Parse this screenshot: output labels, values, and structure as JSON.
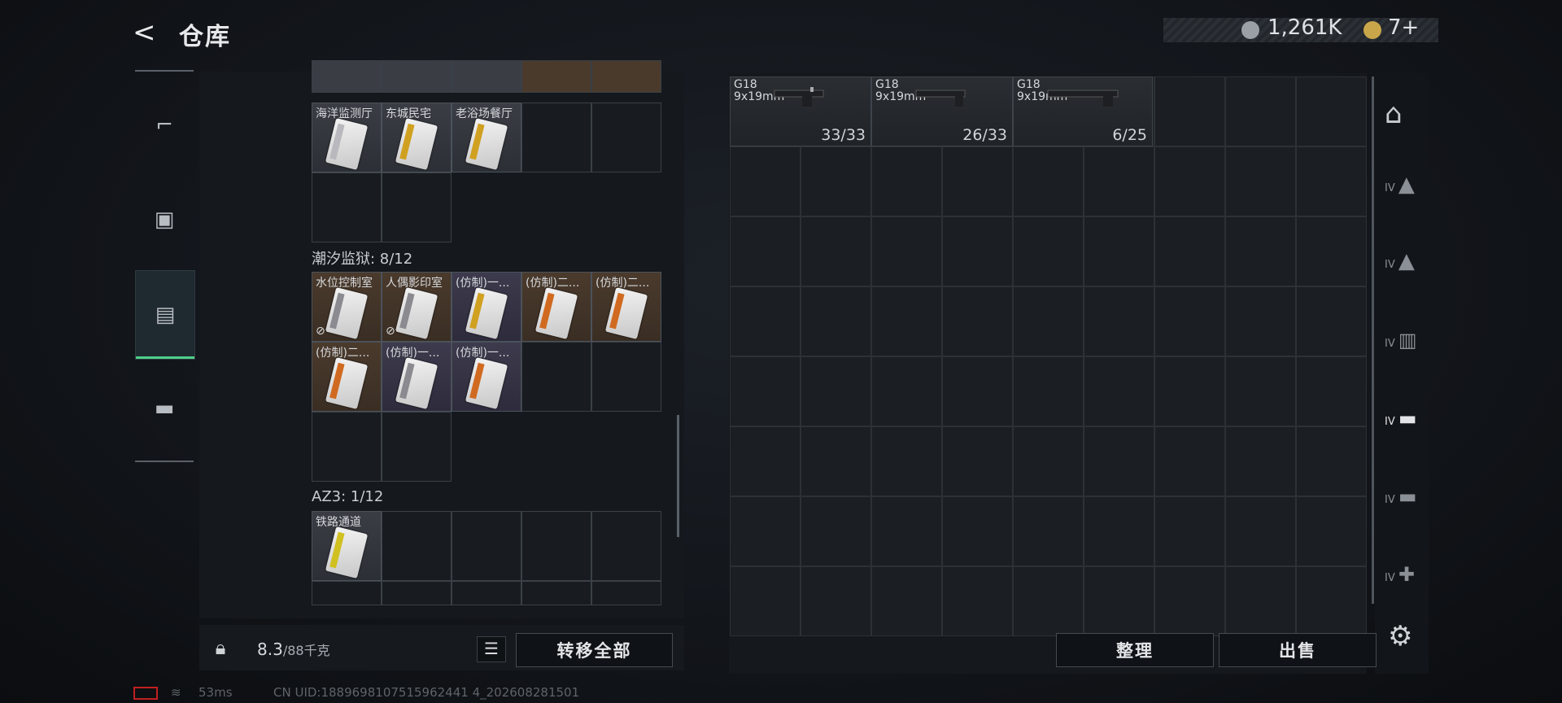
{
  "header": {
    "back_glyph": "<",
    "title": "仓库",
    "currency1": "1,261K",
    "currency2": "7+"
  },
  "nav": [
    {
      "icon": "pistol-icon"
    },
    {
      "icon": "backpack-icon"
    },
    {
      "icon": "container-icon"
    },
    {
      "icon": "toolbox-icon"
    }
  ],
  "top_cards": [
    {
      "label": "海洋监测厅"
    },
    {
      "label": "东城民宅"
    },
    {
      "label": "老浴场餐厅"
    }
  ],
  "section1": {
    "title": "潮汐监狱: 8/12",
    "cards": [
      {
        "label": "水位控制室",
        "color": "brown",
        "stripe": "#8a8a90",
        "locked": true
      },
      {
        "label": "人偶影印室",
        "color": "brown",
        "stripe": "#8a8a90",
        "locked": true
      },
      {
        "label": "(仿制)一...",
        "color": "purple",
        "stripe": "#d0a020"
      },
      {
        "label": "(仿制)二...",
        "color": "brown",
        "stripe": "#d06a20"
      },
      {
        "label": "(仿制)二...",
        "color": "brown",
        "stripe": "#d06a20"
      },
      {
        "label": "(仿制)二...",
        "color": "brown",
        "stripe": "#d06a20"
      },
      {
        "label": "(仿制)一...",
        "color": "purple",
        "stripe": "#8a8a90"
      },
      {
        "label": "(仿制)一...",
        "color": "purple",
        "stripe": "#d06a20"
      }
    ]
  },
  "section2": {
    "title": "AZ3: 1/12",
    "cards": [
      {
        "label": "铁路通道"
      }
    ]
  },
  "bottom": {
    "weight": "8.3",
    "weight_max": "/88千克",
    "transfer_all": "转移全部",
    "sort": "整理",
    "sell": "出售"
  },
  "weapons": [
    {
      "name": "G18",
      "caliber": "9x19mm",
      "ammo": "33/33"
    },
    {
      "name": "G18",
      "caliber": "9x19mm",
      "ammo": "26/33"
    },
    {
      "name": "G18",
      "caliber": "9x19mm",
      "ammo": "6/25"
    }
  ],
  "side_tabs": [
    {
      "icon": "helmet-icon",
      "level": ""
    },
    {
      "icon": "armor-icon",
      "level": "IV"
    },
    {
      "icon": "armor-icon",
      "level": "IV"
    },
    {
      "icon": "container-icon",
      "level": "IV"
    },
    {
      "icon": "rifle-icon",
      "level": "IV"
    },
    {
      "icon": "rifle-icon",
      "level": "IV"
    },
    {
      "icon": "medkit-icon",
      "level": "IV"
    }
  ],
  "footer": {
    "ping": "53ms",
    "uid": "CN UID:1889698107515962441 4_202608281501"
  },
  "colors": {
    "accent": "#4fd08a"
  }
}
